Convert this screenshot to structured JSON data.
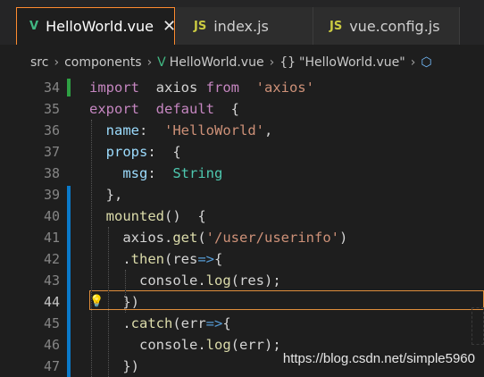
{
  "tabs": [
    {
      "icon": "V",
      "label": "HelloWorld.vue",
      "active": true,
      "close": "✕"
    },
    {
      "icon": "JS",
      "label": "index.js",
      "active": false
    },
    {
      "icon": "JS",
      "label": "vue.config.js",
      "active": false
    }
  ],
  "breadcrumb": {
    "src": "src",
    "components": "components",
    "file": "HelloWorld.vue",
    "braces": "{}",
    "object": "\"HelloWorld.vue\""
  },
  "lines": [
    {
      "n": "34",
      "code": [
        [
          "kw",
          "import"
        ],
        [
          "",
          "  axios "
        ],
        [
          "kw",
          "from"
        ],
        [
          "str",
          "  'axios'"
        ]
      ]
    },
    {
      "n": "35",
      "code": [
        [
          "kw",
          "export"
        ],
        [
          "kw",
          "  default"
        ],
        [
          "",
          "  {"
        ]
      ]
    },
    {
      "n": "36",
      "code": [
        [
          "",
          "  "
        ],
        [
          "prop",
          "name"
        ],
        [
          "",
          ":  "
        ],
        [
          "str",
          "'HelloWorld'"
        ],
        [
          "",
          ","
        ]
      ]
    },
    {
      "n": "37",
      "code": [
        [
          "",
          "  "
        ],
        [
          "prop",
          "props"
        ],
        [
          "",
          ":  {"
        ]
      ]
    },
    {
      "n": "38",
      "code": [
        [
          "",
          "    "
        ],
        [
          "prop",
          "msg"
        ],
        [
          "",
          ":  "
        ],
        [
          "ty",
          "String"
        ]
      ]
    },
    {
      "n": "39",
      "code": [
        [
          "",
          "  },"
        ]
      ]
    },
    {
      "n": "40",
      "code": [
        [
          "",
          "  "
        ],
        [
          "fn",
          "mounted"
        ],
        [
          "",
          "()  {"
        ]
      ]
    },
    {
      "n": "41",
      "code": [
        [
          "",
          "    axios."
        ],
        [
          "fn",
          "get"
        ],
        [
          "",
          "("
        ],
        [
          "str",
          "'/user/userinfo'"
        ],
        [
          "",
          ")"
        ]
      ]
    },
    {
      "n": "42",
      "code": [
        [
          "",
          "    ."
        ],
        [
          "fn",
          "then"
        ],
        [
          "",
          "(res"
        ],
        [
          "arrow",
          "=>"
        ],
        [
          "",
          "{"
        ]
      ]
    },
    {
      "n": "43",
      "code": [
        [
          "",
          "      console."
        ],
        [
          "fn",
          "log"
        ],
        [
          "",
          "(res);"
        ]
      ]
    },
    {
      "n": "44",
      "code": [
        [
          "",
          "    })"
        ]
      ]
    },
    {
      "n": "45",
      "code": [
        [
          "",
          "    ."
        ],
        [
          "fn",
          "catch"
        ],
        [
          "",
          "(err"
        ],
        [
          "arrow",
          "=>"
        ],
        [
          "",
          "{"
        ]
      ]
    },
    {
      "n": "46",
      "code": [
        [
          "",
          "      console."
        ],
        [
          "fn",
          "log"
        ],
        [
          "",
          "(err);"
        ]
      ]
    },
    {
      "n": "47",
      "code": [
        [
          "",
          "    })"
        ]
      ]
    }
  ],
  "watermark": "https://blog.csdn.net/simple5960",
  "colors": {
    "accent": "#ff8c2f",
    "vue": "#41b883",
    "modified": "#0a7aca",
    "added": "#2ea043"
  }
}
